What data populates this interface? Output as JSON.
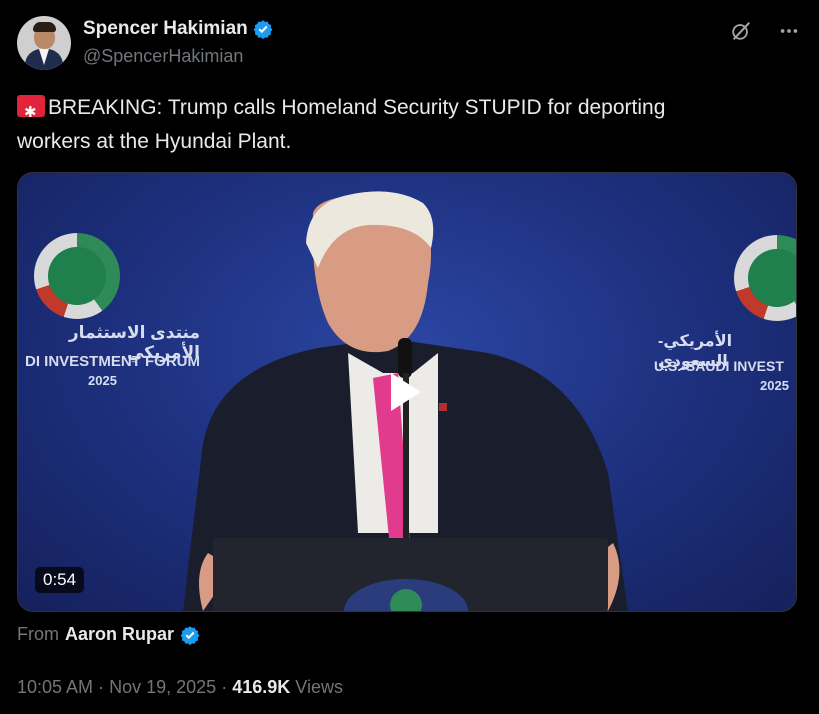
{
  "author": {
    "name": "Spencer Hakimian",
    "handle": "@SpencerHakimian",
    "verified_icon": "verified-badge-icon"
  },
  "header_actions": {
    "grok_icon": "grok-icon",
    "more_icon": "more-options-icon"
  },
  "tweet": {
    "emoji": "rotating-light-icon",
    "line1": "BREAKING: Trump calls Homeland Security STUPID for deporting",
    "line2": "workers at the Hyundai Plant."
  },
  "media": {
    "duration": "0:54",
    "banner_left": {
      "arabic": "منتدى الاستثمار الأمريكي",
      "english": "DI INVESTMENT FORUM",
      "year": "2025"
    },
    "banner_right": {
      "arabic": "الأمريكي-السعودي",
      "english": "U.S.-SAUDI INVEST",
      "year": "2025"
    }
  },
  "source": {
    "from_label": "From",
    "author": "Aaron Rupar"
  },
  "meta": {
    "time": "10:05 AM",
    "separator": "·",
    "date": "Nov 19, 2025",
    "views_count": "416.9K",
    "views_label": "Views"
  },
  "colors": {
    "background": "#000000",
    "text": "#e7e9ea",
    "muted": "#71767b",
    "verified": "#1d9bf0",
    "siren": "#e0243c"
  }
}
